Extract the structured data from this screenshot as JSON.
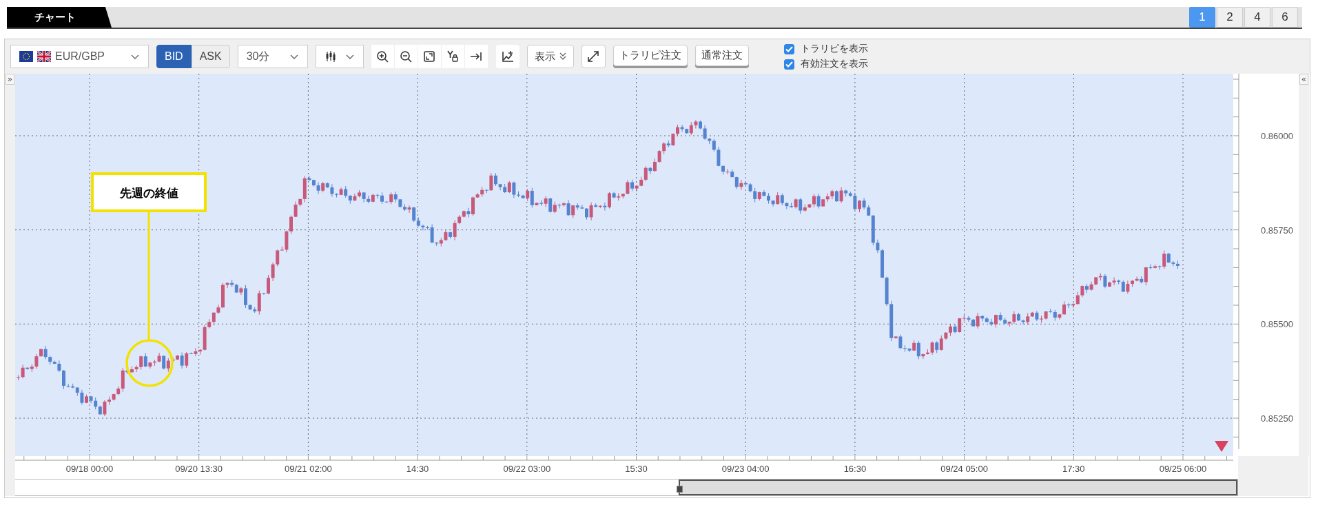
{
  "tabs": [
    {
      "label": "チャート",
      "selected": true
    }
  ],
  "layout_buttons": [
    {
      "label": "1",
      "selected": true
    },
    {
      "label": "2",
      "selected": false
    },
    {
      "label": "4",
      "selected": false
    },
    {
      "label": "6",
      "selected": false
    }
  ],
  "toolbar": {
    "symbol": "EUR/GBP",
    "price_side": [
      {
        "label": "BID",
        "selected": true
      },
      {
        "label": "ASK",
        "selected": false
      }
    ],
    "timeframe": "30分",
    "display_button": "表示",
    "order_buttons": [
      "トラリピ注文",
      "通常注文"
    ],
    "options": [
      {
        "label": "トラリピを表示",
        "checked": true
      },
      {
        "label": "有効注文を表示",
        "checked": true
      }
    ]
  },
  "chart": {
    "left_toggle": "»",
    "right_toggle": "«",
    "annotation": "先週の終値",
    "y_axis_labels": [
      "0.86000",
      "0.85750",
      "0.85500",
      "0.85250"
    ],
    "x_axis_labels": [
      "09/18 00:00",
      "09/20 13:30",
      "09/21 02:00",
      "14:30",
      "09/22 03:00",
      "15:30",
      "09/23 04:00",
      "16:30",
      "09/24 05:00",
      "17:30",
      "09/25 06:00"
    ]
  }
}
